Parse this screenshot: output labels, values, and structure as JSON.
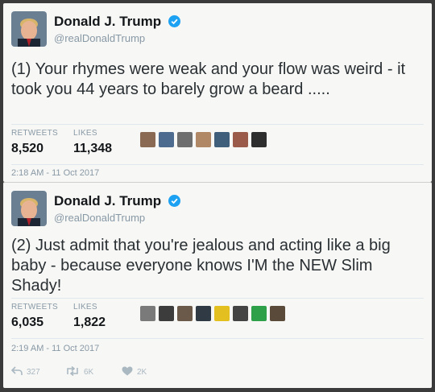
{
  "tweets": [
    {
      "name": "Donald J. Trump",
      "handle": "@realDonaldTrump",
      "text": "(1) Your rhymes were weak and your flow was weird - it took you 44 years to barely grow a beard .....",
      "retweets_label": "RETWEETS",
      "retweets": "8,520",
      "likes_label": "LIKES",
      "likes": "11,348",
      "timestamp": "2:18 AM - 11 Oct 2017",
      "likers": [
        "#8a6a52",
        "#4d6b8f",
        "#6e6e6e",
        "#b08866",
        "#3f5f7a",
        "#9a5b4a",
        "#2e2e2e"
      ]
    },
    {
      "name": "Donald J. Trump",
      "handle": "@realDonaldTrump",
      "text": "(2) Just admit that you're jealous and acting like a big baby - because everyone knows I'M the NEW Slim Shady!",
      "retweets_label": "RETWEETS",
      "retweets": "6,035",
      "likes_label": "LIKES",
      "likes": "1,822",
      "timestamp": "2:19 AM - 11 Oct 2017",
      "likers": [
        "#7a7a7a",
        "#3c3c3c",
        "#6b5a4a",
        "#2f3a45",
        "#e3c020",
        "#444444",
        "#2fa04a",
        "#5a4a3a"
      ],
      "actions": {
        "reply": "327",
        "retweet": "6K",
        "like": "2K"
      }
    }
  ],
  "colors": {
    "verified": "#1da1f2",
    "muted": "#8899a6"
  }
}
